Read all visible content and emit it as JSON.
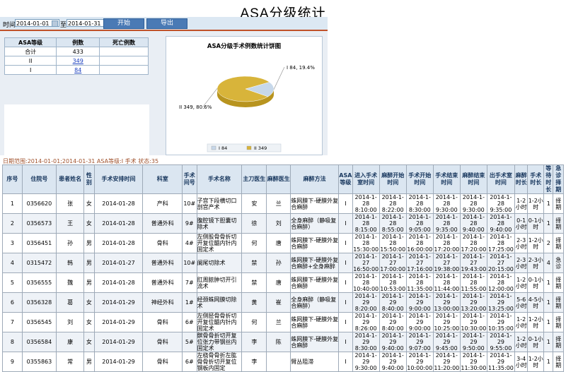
{
  "title": "ASA分级统计",
  "toolbar": {
    "time_label": "时间",
    "to_label": "至",
    "start_date": "2014-01-01",
    "end_date": "2014-01-31",
    "start_btn": "开始",
    "export_btn": "导出"
  },
  "stats": {
    "headers": [
      "ASA等级",
      "例数",
      "死亡例数"
    ],
    "rows": [
      {
        "grade": "合计",
        "count": "433",
        "death": ""
      },
      {
        "grade": "II",
        "count": "349",
        "death": ""
      },
      {
        "grade": "I",
        "count": "84",
        "death": ""
      }
    ]
  },
  "chart_data": {
    "type": "pie",
    "title": "ASA分级手术例数统计饼图",
    "categories": [
      "I",
      "II"
    ],
    "values": [
      84,
      349
    ],
    "slice_labels": [
      "I  84, 19.4%",
      "II  349, 80.6%"
    ],
    "legend_labels": [
      "I  84",
      "II  349"
    ],
    "colors": [
      "#c7d8ea",
      "#d8b43a"
    ]
  },
  "range_text": "日期范围:2014-01-01;2014-01-31 ASA等级:I 手术 状态:35",
  "table": {
    "headers": [
      "序号",
      "住院号",
      "患者姓名",
      "性别",
      "手术安排时间",
      "科室",
      "手术间号",
      "手术名称",
      "主刀医生",
      "麻醉医生",
      "麻醉方法",
      "ASA等级",
      "进入手术室时间",
      "麻醉开始时间",
      "手术开始时间",
      "手术结束时间",
      "麻醉结束时间",
      "出手术室时间",
      "麻醉时长",
      "手术时长",
      "等待时长",
      "急诊择期"
    ],
    "rows": [
      [
        "1",
        "0356620",
        "张",
        "女",
        "2014-01-28",
        "产科",
        "10#",
        "子宫下段横切口剖宫产术",
        "安",
        "兰",
        "蛛网膜下-硬膜外复合麻醉",
        "I",
        "2014-1-28 8:10:00",
        "2014-1-28 8:22:00",
        "2014-1-28 8:30:00",
        "2014-1-28 9:30:00",
        "2014-1-28 9:30:00",
        "2014-1-28 9:35:00",
        "1-2小时",
        "1-2小时",
        "1",
        "择期"
      ],
      [
        "2",
        "0356573",
        "王",
        "女",
        "2014-01-28",
        "普通外科",
        "9#",
        "腹腔镜下胆囊切除术",
        "徐",
        "刘",
        "全身麻醉（静吸复合麻醉）",
        "I",
        "2014-1-28 8:15:00",
        "2014-1-28 8:55:00",
        "2014-1-28 9:05:00",
        "2014-1-28 9:35:00",
        "2014-1-28 9:40:00",
        "2014-1-28 9:40:00",
        "0-1小时",
        "0-1小时",
        "1",
        "择期"
      ],
      [
        "3",
        "0356451",
        "孙",
        "男",
        "2014-01-28",
        "骨科",
        "4#",
        "左侧股骨骨折切开复位髓内针内固定术",
        "何",
        "唐",
        "蛛网膜下-硬膜外复合麻醉",
        "I",
        "2014-1-28 15:30:00",
        "2014-1-28 15:50:00",
        "2014-1-28 16:00:00",
        "2014-1-28 17:20:00",
        "2014-1-28 17:20:00",
        "2014-1-28 17:25:00",
        "2-3小时",
        "1-2小时",
        "2",
        "择期"
      ],
      [
        "4",
        "0315472",
        "韩",
        "男",
        "2014-01-27",
        "普通外科",
        "10#",
        "阑尾切除术",
        "禁",
        "孙",
        "蛛网膜下-硬膜外复合麻醉+全身麻醉",
        "I",
        "2014-1-27 16:50:00",
        "2014-1-27 17:00:00",
        "2014-1-27 17:16:00",
        "2014-1-27 19:38:00",
        "2014-1-27 19:43:00",
        "2014-1-27 20:15:00",
        "2-3小时",
        "2-3小时",
        "4",
        "急诊"
      ],
      [
        "5",
        "0356555",
        "魏",
        "男",
        "2014-01-28",
        "普通外科",
        "7#",
        "肛周脓肿切开引流术",
        "禁",
        "唐",
        "蛛网膜下-硬膜外复合麻醉",
        "I",
        "2014-1-28 10:40:00",
        "2014-1-28 10:53:00",
        "2014-1-28 11:35:00",
        "2014-1-28 11:44:00",
        "2014-1-28 11:55:00",
        "2014-1-28 12:00:00",
        "1-2小时",
        "0-1小时",
        "1",
        "择期"
      ],
      [
        "6",
        "0356328",
        "葛",
        "女",
        "2014-01-29",
        "神经外科",
        "1#",
        "经颈蛛网膜切除术",
        "黄",
        "崔",
        "全身麻醉（静吸复合麻醉）",
        "I",
        "2014-1-29 8:20:00",
        "2014-1-29 8:40:00",
        "2014-1-29 9:00:00",
        "2014-1-29 13:00:00",
        "2014-1-29 13:20:00",
        "2014-1-29 13:25:00",
        "5-6小时",
        "4-5小时",
        "1",
        "择期"
      ],
      [
        "7",
        "0356545",
        "刘",
        "女",
        "2014-01-29",
        "骨科",
        "6#",
        "左侧胫骨骨折切开复位髓内针内固定术",
        "何",
        "兰",
        "蛛网膜下-硬膜外复合麻醉",
        "I",
        "2014-1-29 8:26:00",
        "2014-1-29 8:40:00",
        "2014-1-29 9:00:00",
        "2014-1-29 10:25:00",
        "2014-1-29 10:30:00",
        "2014-1-29 10:35:00",
        "1-2小时",
        "1-2小时",
        "1",
        "择期"
      ],
      [
        "8",
        "0356584",
        "康",
        "女",
        "2014-01-29",
        "骨科",
        "5#",
        "髌骨骨折切开复位张力带钢丝内固定术",
        "李",
        "陈",
        "蛛网膜下-硬膜外复合麻醉",
        "I",
        "2014-1-29 8:30:00",
        "2014-1-29 9:40:00",
        "2014-1-29 9:07:00",
        "2014-1-29 9:45:00",
        "2014-1-29 9:50:00",
        "2014-1-29 9:55:00",
        "1-2小时",
        "0-1小时",
        "1",
        "择期"
      ],
      [
        "9",
        "0355863",
        "常",
        "男",
        "2014-01-29",
        "骨科",
        "6#",
        "左桡骨骨折左肱骨骨折切开复位钢板内固定",
        "李",
        "",
        "臂丛阻滞",
        "I",
        "2014-1-29 9:30:00",
        "2014-1-29 9:40:00",
        "2014-1-29 10:00:00",
        "2014-1-29 11:20:00",
        "2014-1-29 11:30:00",
        "2014-1-29 11:35:00",
        "3-4小时",
        "1-2小时",
        "1",
        "择期"
      ]
    ]
  }
}
